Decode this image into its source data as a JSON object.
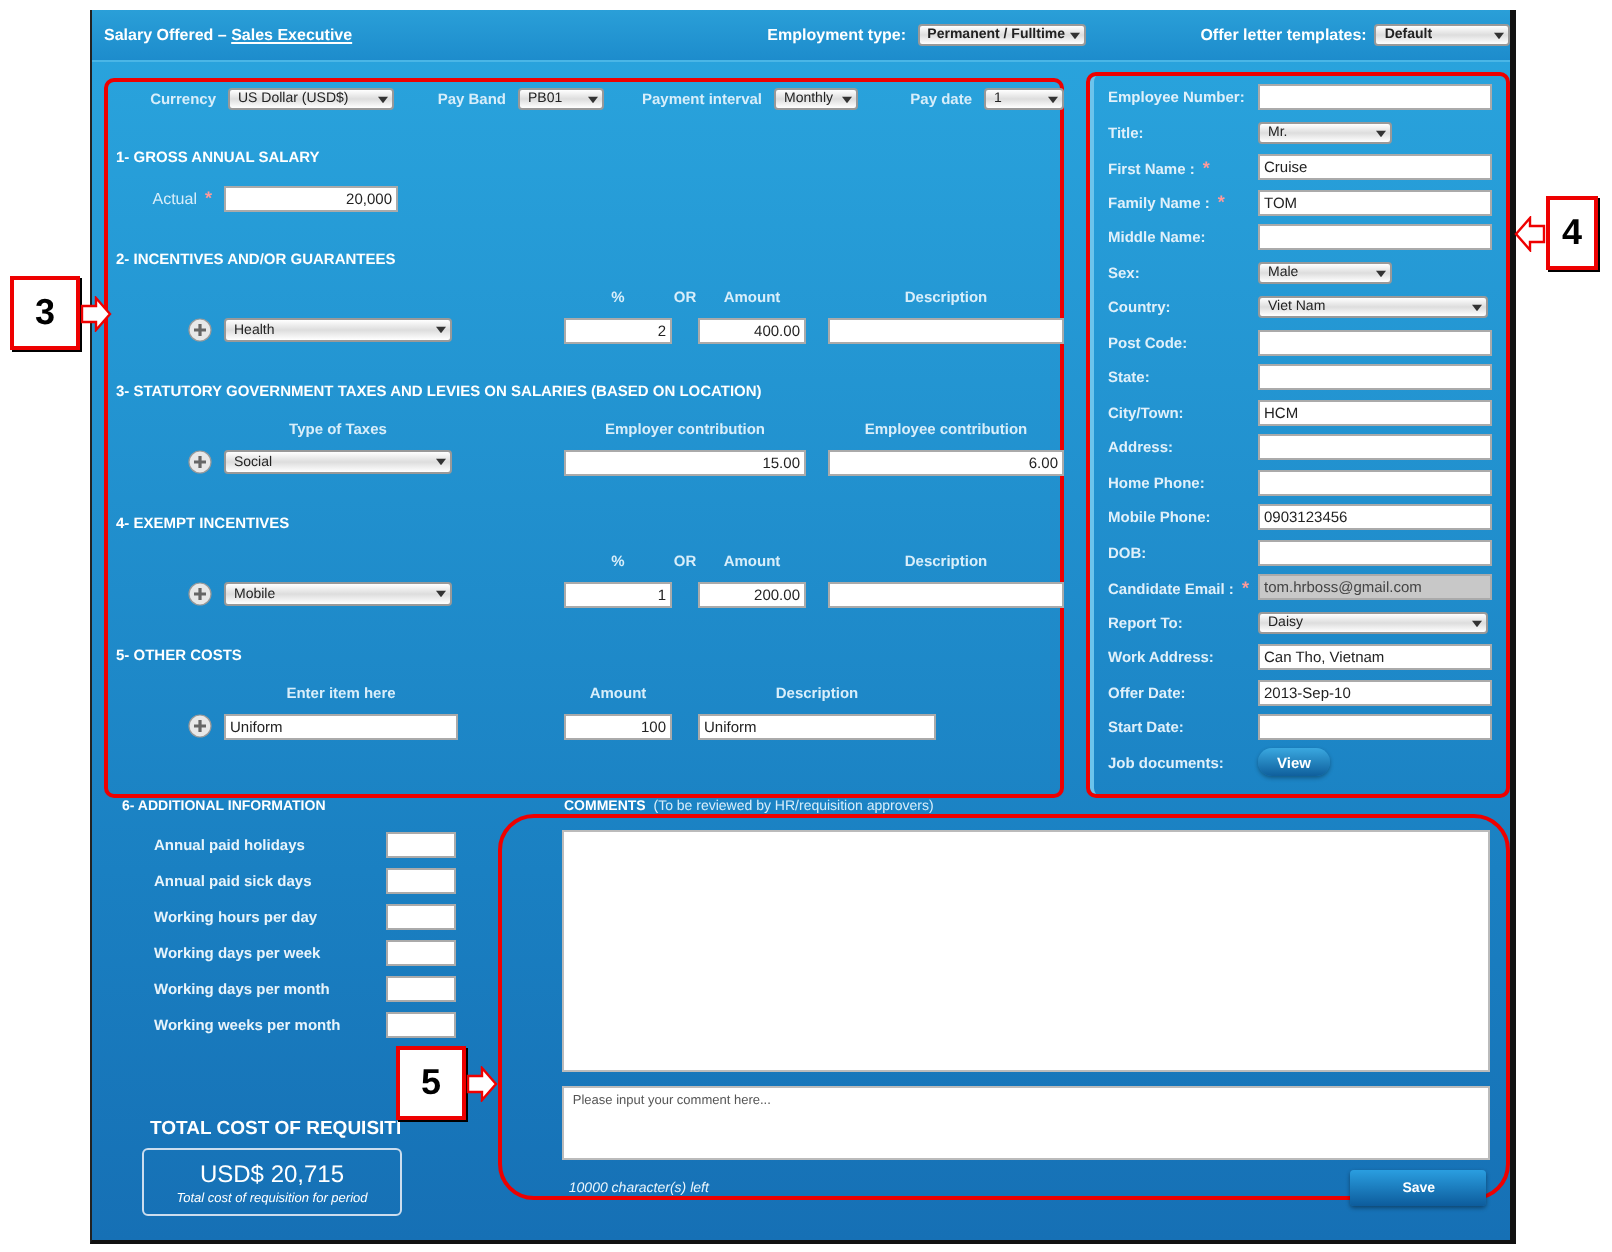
{
  "header": {
    "title": "Salary Offered – ",
    "title_link": "Sales Executive",
    "employment_type": {
      "label": "Employment type:",
      "value": "Permanent / Fulltime"
    },
    "offer_templates": {
      "label": "Offer letter templates:",
      "value": "Default"
    }
  },
  "pay": [
    {
      "label": "Currency",
      "value": "US Dollar (USD$)"
    },
    {
      "label": "Pay Band",
      "value": "PB01"
    },
    {
      "label": "Payment interval",
      "value": "Monthly"
    },
    {
      "label": "Pay date",
      "value": "1"
    }
  ],
  "sections": [
    {
      "heading": "1- GROSS ANNUAL SALARY",
      "kind": "single",
      "label": "Actual",
      "required_mark": "*",
      "value": "20,000"
    },
    {
      "heading": "2- INCENTIVES AND/OR GUARANTEES",
      "kind": "incentive",
      "columns": [
        "%",
        "OR",
        "Amount",
        "Description"
      ],
      "cells": [
        {
          "kind": "select",
          "value": "Health"
        },
        {
          "kind": "input",
          "value": "2"
        },
        {
          "kind": "input",
          "value": "400.00"
        },
        {
          "kind": "input"
        }
      ]
    },
    {
      "heading": "3- STATUTORY GOVERNMENT TAXES AND LEVIES ON SALARIES (BASED ON LOCATION)",
      "kind": "tax",
      "columns": [
        "Type of Taxes",
        "Employer contribution",
        "Employee contribution"
      ],
      "cells": [
        {
          "kind": "select",
          "value": "Social"
        },
        {
          "kind": "input",
          "value": "15.00"
        },
        {
          "kind": "input",
          "value": "6.00"
        }
      ]
    },
    {
      "heading": "4- EXEMPT INCENTIVES",
      "kind": "incentive",
      "columns": [
        "%",
        "OR",
        "Amount",
        "Description"
      ],
      "cells": [
        {
          "kind": "select",
          "value": "Mobile"
        },
        {
          "kind": "input",
          "value": "1"
        },
        {
          "kind": "input",
          "value": "200.00"
        },
        {
          "kind": "input"
        }
      ]
    },
    {
      "heading": "5- OTHER COSTS",
      "kind": "other",
      "columns": [
        "Enter item here",
        "Amount",
        "Description"
      ],
      "cells": [
        {
          "kind": "input",
          "value": "Uniform"
        },
        {
          "kind": "input",
          "value": "100"
        },
        {
          "kind": "input",
          "value": "Uniform"
        }
      ]
    }
  ],
  "employee": [
    {
      "label": "Employee Number:",
      "kind": "text"
    },
    {
      "label": "Title:",
      "kind": "short-select",
      "value": "Mr."
    },
    {
      "label": "First Name :",
      "kind": "text",
      "required_mark": "*",
      "value": "Cruise"
    },
    {
      "label": "Family Name :",
      "kind": "text",
      "required_mark": "*",
      "value": "TOM"
    },
    {
      "label": "Middle Name:",
      "kind": "text"
    },
    {
      "label": "Sex:",
      "kind": "short-select",
      "value": "Male"
    },
    {
      "label": "Country:",
      "kind": "select",
      "value": "Viet Nam"
    },
    {
      "label": "Post Code:",
      "kind": "text"
    },
    {
      "label": "State:",
      "kind": "text"
    },
    {
      "label": "City/Town:",
      "kind": "text",
      "value": "HCM"
    },
    {
      "label": "Address:",
      "kind": "text"
    },
    {
      "label": "Home Phone:",
      "kind": "text"
    },
    {
      "label": "Mobile Phone:",
      "kind": "text",
      "value": "0903123456"
    },
    {
      "label": "DOB:",
      "kind": "text"
    },
    {
      "label": "Candidate Email :",
      "kind": "text",
      "required_mark": "*",
      "disabled": true,
      "value": "tom.hrboss@gmail.com"
    },
    {
      "label": "Report To:",
      "kind": "select",
      "value": "Daisy"
    },
    {
      "label": "Work Address:",
      "kind": "text",
      "value": "Can Tho, Vietnam"
    },
    {
      "label": "Offer Date:",
      "kind": "text",
      "value": "2013-Sep-10"
    },
    {
      "label": "Start Date:",
      "kind": "text"
    },
    {
      "label": "Job documents:",
      "kind": "button",
      "value": "View"
    }
  ],
  "additional": {
    "heading": "6- ADDITIONAL INFORMATION",
    "fields": [
      "Annual paid holidays",
      "Annual paid sick days",
      "Working hours per day",
      "Working days per week",
      "Working days per month",
      "Working weeks per month"
    ]
  },
  "comments": {
    "heading": "COMMENTS",
    "note": "(To be reviewed by HR/requisition approvers)",
    "placeholder": "Please input your comment here...",
    "remaining": "10000  character(s) left",
    "save": "Save"
  },
  "total": {
    "heading": "TOTAL COST OF REQUISITI",
    "amount": "USD$ 20,715",
    "caption": "Total cost of requisition for period"
  },
  "annotations": [
    {
      "label": "3",
      "kind": "arrow-right"
    },
    {
      "label": "4",
      "kind": "arrow-left"
    },
    {
      "label": "5",
      "kind": "arrow-right"
    }
  ]
}
